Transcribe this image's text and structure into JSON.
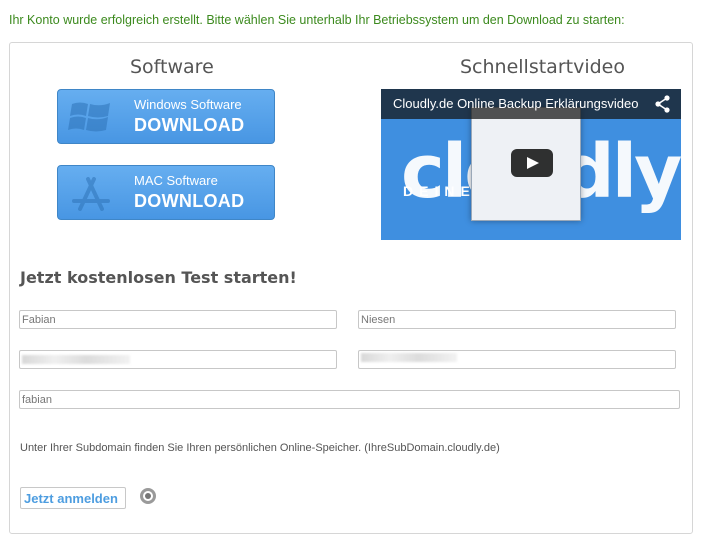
{
  "message": "Ihr Konto wurde erfolgreich erstellt. Bitte wählen Sie unterhalb Ihr Betriebssystem um den Download zu starten:",
  "software": {
    "title": "Software",
    "windows": {
      "line1": "Windows Software",
      "line2": "DOWNLOAD"
    },
    "mac": {
      "line1": "MAC Software",
      "line2": "DOWNLOAD"
    }
  },
  "video": {
    "section_title": "Schnellstartvideo",
    "title": "Cloudly.de Online Backup Erklärungsvideo",
    "brand": "cloudly",
    "tagline": "DEINE ... ER",
    "accent": "#3f8fe0"
  },
  "form": {
    "title": "Jetzt kostenlosen Test starten!",
    "first_name": "Fabian",
    "last_name": "Niesen",
    "email": "",
    "password": "",
    "subdomain": "fabian",
    "hint": "Unter Ihrer Subdomain finden Sie Ihren persönlichen Online-Speicher. (IhreSubDomain.cloudly.de)",
    "submit": "Jetzt anmelden"
  },
  "colors": {
    "success": "#3c8a1e",
    "button": "#4896e3",
    "link": "#4d9de0"
  }
}
